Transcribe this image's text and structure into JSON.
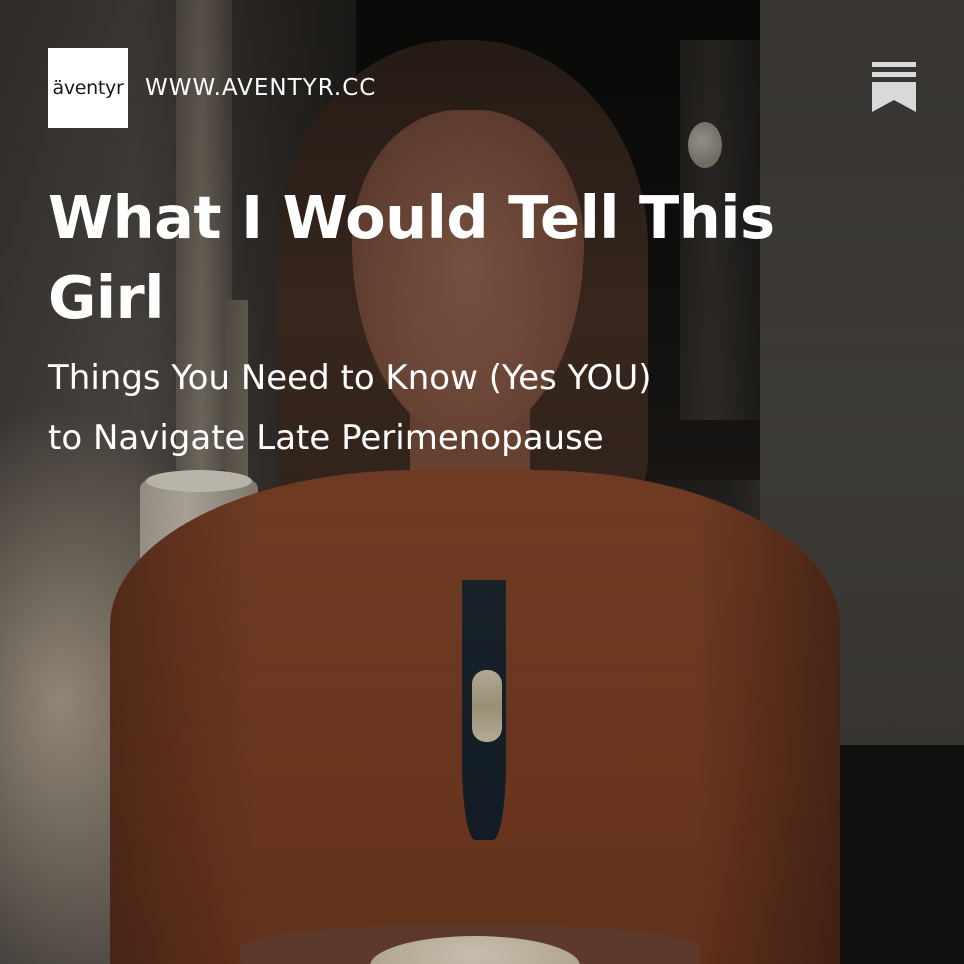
{
  "brand": {
    "logo_text": "äventyr",
    "site_url": "WWW.AVENTYR.CC"
  },
  "header": {
    "bookmark_icon": "bookmark-icon"
  },
  "post": {
    "title": "What I Would Tell This Girl",
    "subtitle_line1": "Things You Need to Know (Yes YOU)",
    "subtitle_line2": "to Navigate Late Perimenopause"
  },
  "colors": {
    "text": "#ffffff",
    "logo_bg": "#ffffff",
    "bookmark": "#d9d9d9",
    "jacket": "#8c4a2c"
  }
}
